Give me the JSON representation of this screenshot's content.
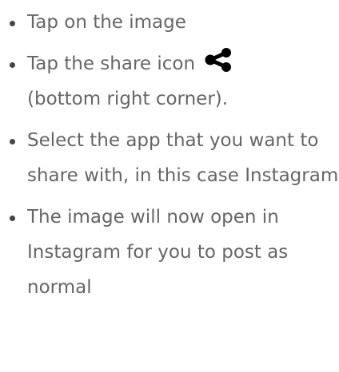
{
  "steps": [
    {
      "text": "Tap on the image"
    },
    {
      "text": "Tap the share icon",
      "icon": "share-icon",
      "text_after": "(bottom right corner)."
    },
    {
      "text": "Select the app that you want to share with, in this case Instagram"
    },
    {
      "text": "The image will now open in Instagram for you to post as normal"
    }
  ],
  "colors": {
    "text": "#666666",
    "icon": "#000000"
  }
}
